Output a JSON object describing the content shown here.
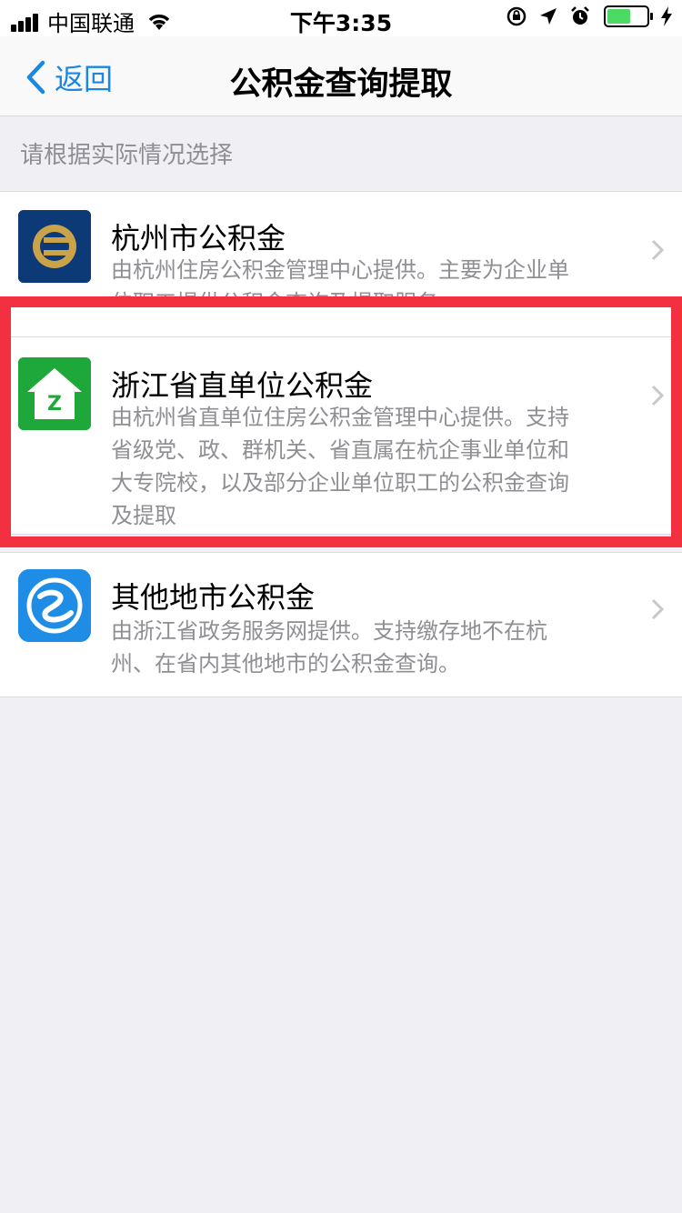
{
  "status_bar": {
    "carrier": "中国联通",
    "time": "下午3:35"
  },
  "nav": {
    "back_label": "返回",
    "title": "公积金查询提取"
  },
  "section_header": "请根据实际情况选择",
  "items": [
    {
      "title": "杭州市公积金",
      "desc": "由杭州住房公积金管理中心提供。主要为企业单位职工提供公积金查询及提取服务"
    },
    {
      "title": "浙江省直单位公积金",
      "desc": "由杭州省直单位住房公积金管理中心提供。支持省级党、政、群机关、省直属在杭企事业单位和大专院校，以及部分企业单位职工的公积金查询及提取"
    },
    {
      "title": "其他地市公积金",
      "desc": "由浙江省政务服务网提供。支持缴存地不在杭州、在省内其他地市的公积金查询。"
    }
  ],
  "colors": {
    "accent": "#1a88e3",
    "highlight": "#f2303f",
    "background": "#efeff4"
  }
}
